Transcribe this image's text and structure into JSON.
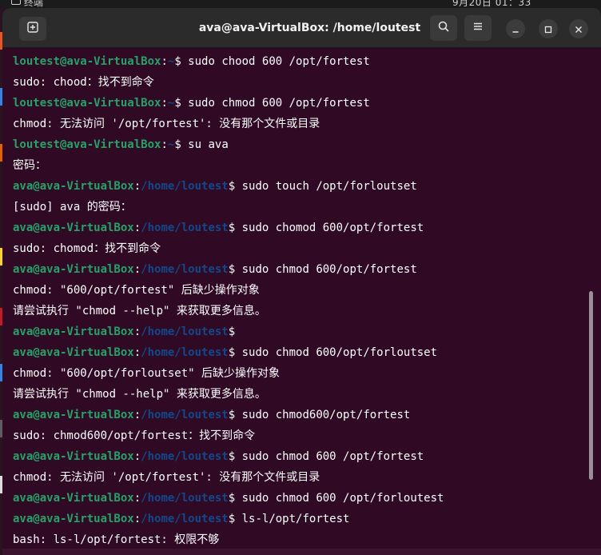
{
  "topbar": {
    "app_label": "终端",
    "clock": "9月20日 01：33"
  },
  "window": {
    "title": "ava@ava-VirtualBox: /home/loutest"
  },
  "icons": {
    "new_tab": "new-tab-icon",
    "search": "search-icon",
    "menu": "hamburger-menu-icon",
    "minimize": "minimize-icon",
    "maximize": "maximize-icon",
    "close": "close-icon"
  },
  "colors": {
    "terminal_bg": "#300a24",
    "user_host": "#26a269",
    "path": "#12488b",
    "text": "#ffffff"
  },
  "terminal": {
    "lines": [
      {
        "user": "loutest@ava-VirtualBox",
        "sep": ":",
        "path": "~",
        "prompt": "$",
        "cmd": " sudo chood 600 /opt/fortest"
      },
      {
        "text": "sudo: chood：找不到命令"
      },
      {
        "user": "loutest@ava-VirtualBox",
        "sep": ":",
        "path": "~",
        "prompt": "$",
        "cmd": " sudo chmod 600 /opt/fortest"
      },
      {
        "text": "chmod: 无法访问 '/opt/fortest': 没有那个文件或目录"
      },
      {
        "user": "loutest@ava-VirtualBox",
        "sep": ":",
        "path": "~",
        "prompt": "$",
        "cmd": " su ava"
      },
      {
        "text": "密码："
      },
      {
        "user": "ava@ava-VirtualBox",
        "sep": ":",
        "path": "/home/loutest",
        "prompt": "$",
        "cmd": " sudo touch /opt/forloutset"
      },
      {
        "text": "[sudo] ava 的密码："
      },
      {
        "user": "ava@ava-VirtualBox",
        "sep": ":",
        "path": "/home/loutest",
        "prompt": "$",
        "cmd": " sudo chomod 600/opt/fortest"
      },
      {
        "text": "sudo: chomod：找不到命令"
      },
      {
        "user": "ava@ava-VirtualBox",
        "sep": ":",
        "path": "/home/loutest",
        "prompt": "$",
        "cmd": " sudo chmod 600/opt/fortest"
      },
      {
        "text": "chmod: \"600/opt/fortest\" 后缺少操作对象"
      },
      {
        "text": "请尝试执行 \"chmod --help\" 来获取更多信息。"
      },
      {
        "user": "ava@ava-VirtualBox",
        "sep": ":",
        "path": "/home/loutest",
        "prompt": "$",
        "cmd": ""
      },
      {
        "user": "ava@ava-VirtualBox",
        "sep": ":",
        "path": "/home/loutest",
        "prompt": "$",
        "cmd": " sudo chmod 600/opt/forloutset"
      },
      {
        "text": "chmod: \"600/opt/forloutset\" 后缺少操作对象"
      },
      {
        "text": "请尝试执行 \"chmod --help\" 来获取更多信息。"
      },
      {
        "user": "ava@ava-VirtualBox",
        "sep": ":",
        "path": "/home/loutest",
        "prompt": "$",
        "cmd": " sudo chmod600/opt/fortest"
      },
      {
        "text": "sudo: chmod600/opt/fortest：找不到命令"
      },
      {
        "user": "ava@ava-VirtualBox",
        "sep": ":",
        "path": "/home/loutest",
        "prompt": "$",
        "cmd": " sudo chmod 600 /opt/fortest"
      },
      {
        "text": "chmod: 无法访问 '/opt/fortest': 没有那个文件或目录"
      },
      {
        "user": "ava@ava-VirtualBox",
        "sep": ":",
        "path": "/home/loutest",
        "prompt": "$",
        "cmd": " sudo chmod 600 /opt/forloutest"
      },
      {
        "user": "ava@ava-VirtualBox",
        "sep": ":",
        "path": "/home/loutest",
        "prompt": "$",
        "cmd": " ls-l/opt/fortest"
      },
      {
        "text": "bash: ls-l/opt/fortest: 权限不够"
      }
    ]
  }
}
